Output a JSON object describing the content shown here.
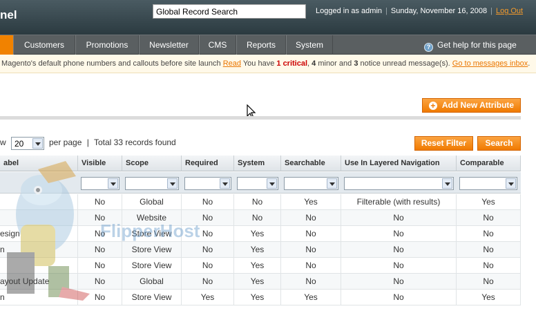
{
  "header": {
    "logo_text": "nel",
    "search_value": "Global Record Search",
    "logged_in": "Logged in as admin",
    "date": "Sunday, November 16, 2008",
    "logout": "Log Out"
  },
  "nav": {
    "items": [
      "Customers",
      "Promotions",
      "Newsletter",
      "CMS",
      "Reports",
      "System"
    ],
    "help": "Get help for this page"
  },
  "notice": {
    "part1": "Magento's default phone numbers and callouts before site launch ",
    "read": "Read",
    "part2": " You have ",
    "critical": "1 critical",
    "part3": ", ",
    "minor_count": "4",
    "part4": " minor and ",
    "notice_count": "3",
    "part5": " notice unread message(s). ",
    "link": "Go to messages inbox",
    "part6": "."
  },
  "actions": {
    "add_attribute": "Add New Attribute",
    "reset_filter": "Reset Filter",
    "search": "Search"
  },
  "pager": {
    "view_prefix": "w",
    "per_page_value": "20",
    "per_page_label": "per page",
    "sep": "|",
    "total": "Total 33 records found"
  },
  "grid": {
    "columns": [
      "Label",
      "Visible",
      "Scope",
      "Required",
      "System",
      "Searchable",
      "Use In Layered Navigation",
      "Comparable"
    ],
    "column_header_shown": [
      "abel",
      "Visible",
      "Scope",
      "Required",
      "System",
      "Searchable",
      "Use In Layered Navigation",
      "Comparable"
    ],
    "rows": [
      [
        "",
        "No",
        "Global",
        "No",
        "No",
        "Yes",
        "Filterable (with results)",
        "Yes"
      ],
      [
        "",
        "No",
        "Website",
        "No",
        "No",
        "No",
        "No",
        "No"
      ],
      [
        "esign",
        "No",
        "Store View",
        "No",
        "Yes",
        "No",
        "No",
        "No"
      ],
      [
        "n",
        "No",
        "Store View",
        "No",
        "Yes",
        "No",
        "No",
        "No"
      ],
      [
        "",
        "No",
        "Store View",
        "No",
        "Yes",
        "No",
        "No",
        "No"
      ],
      [
        "ayout Update",
        "No",
        "Global",
        "No",
        "Yes",
        "No",
        "No",
        "No"
      ],
      [
        "n",
        "No",
        "Store View",
        "Yes",
        "Yes",
        "Yes",
        "No",
        "Yes"
      ]
    ]
  },
  "watermark": {
    "text": "FlipperHost"
  },
  "colors": {
    "accent": "#f07a00",
    "header": "#2b3a40",
    "nav": "#5a5f61"
  }
}
